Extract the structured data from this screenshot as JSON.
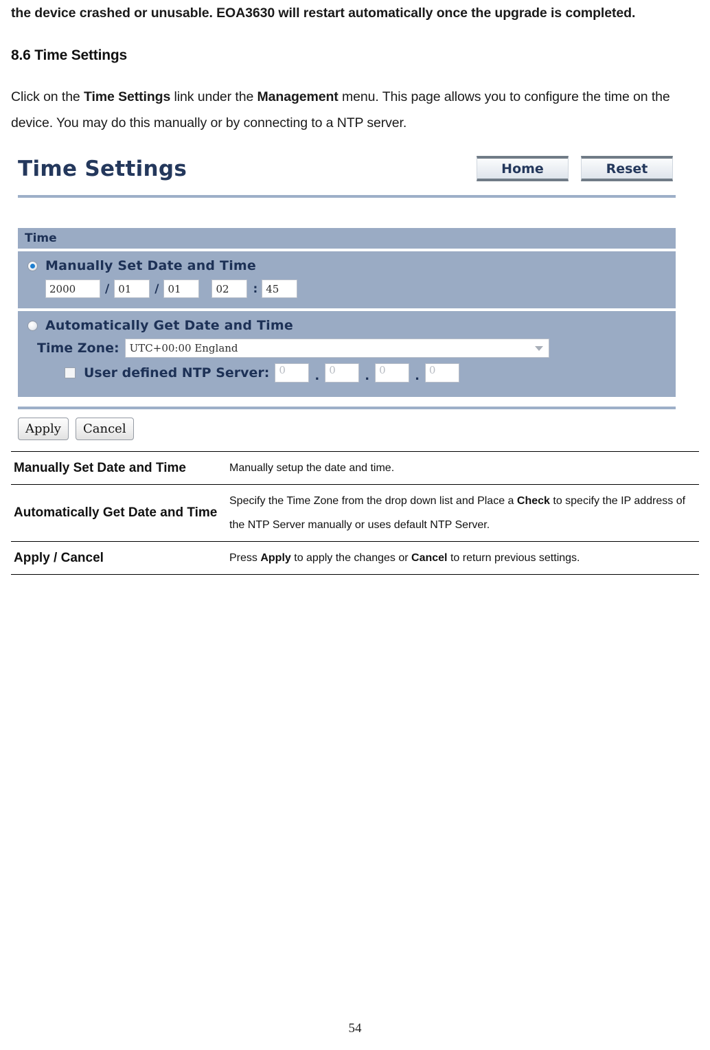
{
  "document": {
    "intro_paragraph": "the device crashed or unusable. EOA3630 will restart automatically once the upgrade is completed.",
    "section_heading": "8.6 Time Settings",
    "lead_prefix": "Click on the ",
    "lead_bold_1": "Time Settings",
    "lead_mid": " link under the ",
    "lead_bold_2": "Management",
    "lead_suffix": " menu. This page allows you to configure the time on the device. You may do this manually or by connecting to a NTP server.",
    "page_number": "54"
  },
  "screenshot": {
    "title": "Time Settings",
    "header_buttons": [
      {
        "label": "Home",
        "name": "home-button"
      },
      {
        "label": "Reset",
        "name": "reset-button"
      }
    ],
    "section_header": "Time",
    "manual": {
      "option_label": "Manually  Set Date and Time",
      "selected": true,
      "year": "2000",
      "month": "01",
      "day": "01",
      "hour": "02",
      "minute": "45",
      "date_separator": "/",
      "time_separator": ":"
    },
    "automatic": {
      "option_label": "Automatically Get Date and Time",
      "selected": false,
      "timezone_label": "Time Zone:",
      "timezone_value": "UTC+00:00 England",
      "ntp_checkbox_checked": false,
      "ntp_label": "User defined NTP Server:",
      "ntp_octets": [
        "0",
        "0",
        "0",
        "0"
      ],
      "ntp_separator": "."
    },
    "actions": [
      {
        "label": "Apply",
        "name": "apply-button"
      },
      {
        "label": "Cancel",
        "name": "cancel-button"
      }
    ],
    "colors": {
      "panel_blue": "#9aabc4",
      "rule_blue": "#9dafc8",
      "title_navy": "#24385c",
      "radio_dot": "#1f7fd0"
    }
  },
  "desc_table": {
    "rows": [
      {
        "term": "Manually Set Date and Time",
        "desc_parts": [
          {
            "text": "Manually setup the date and time.",
            "bold": false
          }
        ]
      },
      {
        "term": "Automatically Get Date and Time",
        "desc_parts": [
          {
            "text": "Specify the Time Zone from the drop down list and Place a ",
            "bold": false
          },
          {
            "text": "Check",
            "bold": true
          },
          {
            "text": " to specify the IP address of the NTP Server manually or uses default NTP Server.",
            "bold": false
          }
        ]
      },
      {
        "term": "Apply / Cancel",
        "desc_parts": [
          {
            "text": "Press ",
            "bold": false
          },
          {
            "text": "Apply",
            "bold": true
          },
          {
            "text": " to apply the changes or ",
            "bold": false
          },
          {
            "text": "Cancel",
            "bold": true
          },
          {
            "text": " to return previous settings.",
            "bold": false
          }
        ]
      }
    ]
  }
}
